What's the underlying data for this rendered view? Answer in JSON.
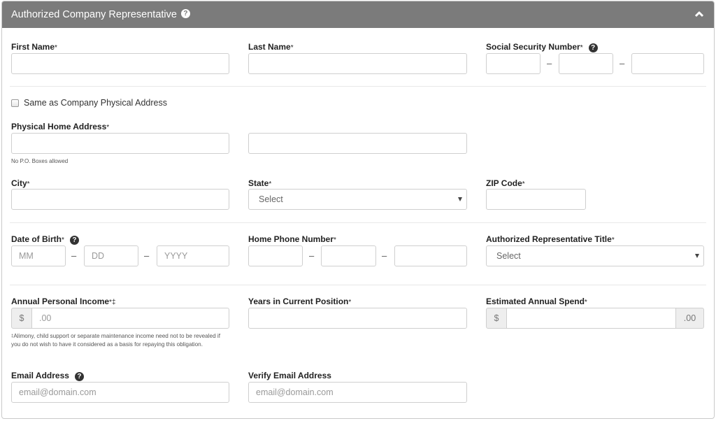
{
  "panel": {
    "title": "Authorized Company Representative",
    "help_glyph": "?",
    "collapse_icon": "chevron-up-icon"
  },
  "fields": {
    "first_name": {
      "label": "First Name",
      "required": "*",
      "value": ""
    },
    "last_name": {
      "label": "Last Name",
      "required": "*",
      "value": ""
    },
    "ssn": {
      "label": "Social Security Number",
      "required": "*",
      "help_glyph": "?",
      "parts": [
        "",
        "",
        ""
      ],
      "separator": "–"
    },
    "same_as_company": {
      "label": "Same as Company Physical Address",
      "checked": false
    },
    "home_address": {
      "label": "Physical Home Address",
      "required": "*",
      "line1": "",
      "line2": "",
      "hint": "No P.O. Boxes allowed"
    },
    "city": {
      "label": "City",
      "required": "*",
      "value": ""
    },
    "state": {
      "label": "State",
      "required": "*",
      "selected": "Select"
    },
    "zip": {
      "label": "ZIP Code",
      "required": "*",
      "value": ""
    },
    "dob": {
      "label": "Date of Birth",
      "required": "*",
      "help_glyph": "?",
      "placeholders": [
        "MM",
        "DD",
        "YYYY"
      ],
      "separator": "–"
    },
    "home_phone": {
      "label": "Home Phone Number",
      "required": "*",
      "parts": [
        "",
        "",
        ""
      ],
      "separator": "–"
    },
    "rep_title": {
      "label": "Authorized Representative Title",
      "required": "*",
      "selected": "Select"
    },
    "annual_income": {
      "label": "Annual Personal Income",
      "required": "*",
      "mark": "‡",
      "prefix": "$",
      "placeholder": ".00",
      "footnote_mark": "‡",
      "footnote": "Alimony, child support or separate maintenance income need not to be revealed if you do not wish to have it considered as a basis for repaying this obligation."
    },
    "years_position": {
      "label": "Years in Current Position",
      "required": "*",
      "value": ""
    },
    "annual_spend": {
      "label": "Estimated Annual Spend",
      "required": "*",
      "prefix": "$",
      "suffix": ".00",
      "value": ""
    },
    "email": {
      "label": "Email Address",
      "help_glyph": "?",
      "placeholder": "email@domain.com"
    },
    "verify_email": {
      "label": "Verify Email Address",
      "placeholder": "email@domain.com"
    }
  }
}
